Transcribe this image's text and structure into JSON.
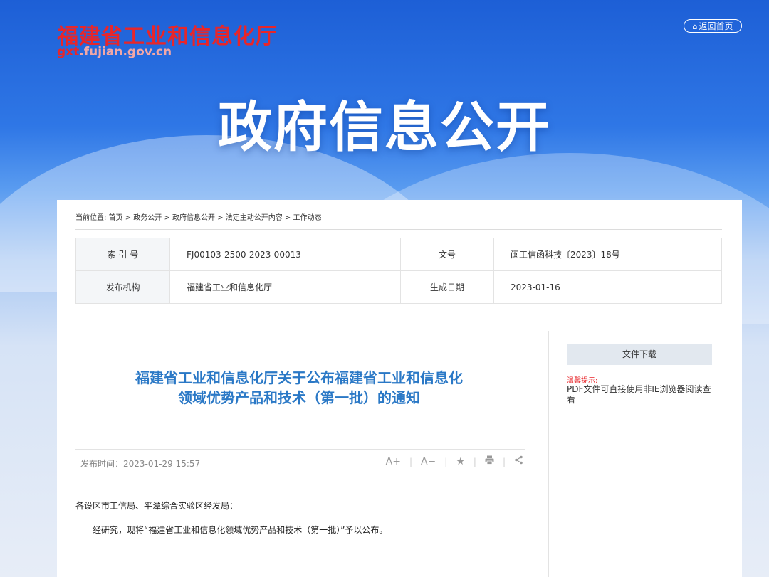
{
  "header": {
    "logo_cn": "福建省工业和信息化厅",
    "logo_en_prefix": "gxt",
    "logo_en_rest": ".fujian.gov.cn",
    "home_button": "返回首页",
    "banner": "政府信息公开"
  },
  "breadcrumb": "当前位置: 首页 > 政务公开 > 政府信息公开 > 法定主动公开内容 > 工作动态",
  "meta": {
    "index_label": "索 引 号",
    "index_value": "FJ00103-2500-2023-00013",
    "doc_no_label": "文号",
    "doc_no_value": "闽工信函科技〔2023〕18号",
    "org_label": "发布机构",
    "org_value": "福建省工业和信息化厅",
    "date_label": "生成日期",
    "date_value": "2023-01-16"
  },
  "article": {
    "title": "福建省工业和信息化厅关于公布福建省工业和信息化领域优势产品和技术（第一批）的通知",
    "publish_time": "发布时间：2023-01-29 15:57",
    "tools": {
      "font_increase": "A+",
      "font_decrease": "A−"
    },
    "salutation": "各设区市工信局、平潭综合实验区经发局：",
    "paragraph1": "经研究，现将“福建省工业和信息化领域优势产品和技术（第一批）”予以公布。"
  },
  "sidebar": {
    "download_button": "文件下载",
    "tip_label": "温馨提示:",
    "tip_text": "PDF文件可直接使用非IE浏览器阅读查看"
  },
  "colors": {
    "brand_red": "#e8262a",
    "title_blue": "#2a78c6",
    "hero_blue": "#2f77e6"
  }
}
